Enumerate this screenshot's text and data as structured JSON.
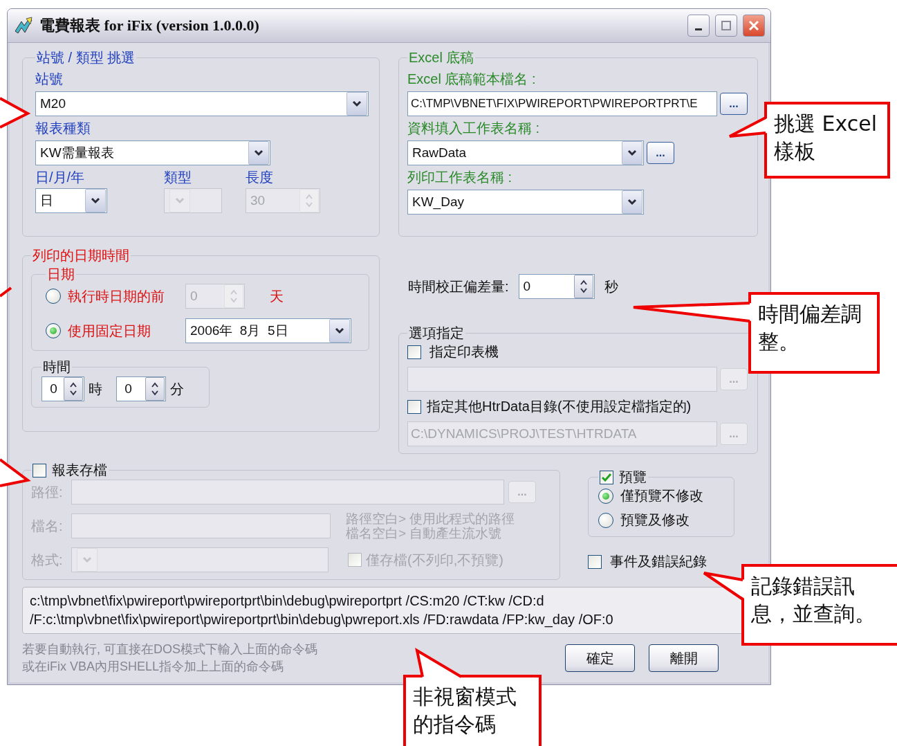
{
  "window": {
    "title": "電費報表 for iFix (version 1.0.0.0)"
  },
  "station_group": {
    "title": "站號 / 類型 挑選",
    "station": {
      "label": "站號",
      "value": "M20"
    },
    "report_type": {
      "label": "報表種類",
      "value": "KW需量報表"
    },
    "period": {
      "label": "日/月/年",
      "value": "日"
    },
    "type": {
      "label": "類型",
      "disabled": true
    },
    "length": {
      "label": "長度",
      "value": "30",
      "disabled": true
    }
  },
  "excel_group": {
    "title": "Excel 底稿",
    "template": {
      "label": "Excel 底稿範本檔名 :",
      "value": "C:\\TMP\\VBNET\\FIX\\PWIREPORT\\PWIREPORTPRT\\E",
      "button": "..."
    },
    "data_sheet": {
      "label": "資料填入工作表名稱 :",
      "value": "RawData",
      "button": "..."
    },
    "print_sheet": {
      "label": "列印工作表名稱 :",
      "value": "KW_Day"
    }
  },
  "print_group": {
    "title": "列印的日期時間",
    "date": {
      "title": "日期",
      "options": [
        {
          "label": "執行時日期的前",
          "selected": false
        },
        {
          "label": "使用固定日期",
          "selected": true
        }
      ],
      "days_before": {
        "value": "0",
        "disabled": true
      },
      "days_unit": "天",
      "fixed_date": "2006年  8月  5日"
    },
    "time": {
      "title": "時間",
      "hour": "0",
      "hour_unit": "時",
      "minute": "0",
      "minute_unit": "分"
    }
  },
  "time_offset": {
    "label": "時間校正偏差量:",
    "value": "0",
    "unit": "秒"
  },
  "options_group": {
    "title": "選項指定",
    "printer": {
      "label": "指定印表機",
      "checked": false,
      "disabled": true,
      "button": "..."
    },
    "htrdata": {
      "label": "指定其他HtrData目錄(不使用設定檔指定的)",
      "checked": false,
      "disabled": true,
      "value": "C:\\DYNAMICS\\PROJ\\TEST\\HTRDATA",
      "button": "..."
    }
  },
  "save_group": {
    "title": "報表存檔",
    "checked": false,
    "disabled": true,
    "path": {
      "label": "路徑:",
      "button": "..."
    },
    "filename": {
      "label": "檔名:"
    },
    "format": {
      "label": "格式:"
    },
    "hint": [
      "路徑空白> 使用此程式的路徑",
      "檔名空白> 自動產生流水號"
    ],
    "save_only": {
      "label": "僅存檔(不列印,不預覽)",
      "checked": false
    }
  },
  "preview_group": {
    "title": "預覽",
    "checked": true,
    "options": [
      {
        "label": "僅預覽不修改",
        "selected": true
      },
      {
        "label": "預覽及修改",
        "selected": false
      }
    ]
  },
  "event_log": {
    "label": "事件及錯誤紀錄",
    "checked": false
  },
  "command": [
    "c:\\tmp\\vbnet\\fix\\pwireport\\pwireportprt\\bin\\debug\\pwireportprt /CS:m20 /CT:kw /CD:d",
    "/F:c:\\tmp\\vbnet\\fix\\pwireport\\pwireportprt\\bin\\debug\\pwreport.xls /FD:rawdata /FP:kw_day /OF:0"
  ],
  "note": [
    "若要自動執行, 可直接在DOS模式下輸入上面的命令碼",
    "或在iFix VBA內用SHELL指令加上上面的命令碼"
  ],
  "buttons": [
    "確定",
    "離開"
  ],
  "callouts": [
    {
      "lines": [
        "挑選 Excel",
        "樣板"
      ]
    },
    {
      "lines": [
        "時間偏差調",
        "整。"
      ]
    },
    {
      "lines": [
        "記錄錯誤訊",
        "息，並查詢。"
      ]
    },
    {
      "lines": [
        "非視窗模式",
        "的指令碼"
      ]
    }
  ]
}
